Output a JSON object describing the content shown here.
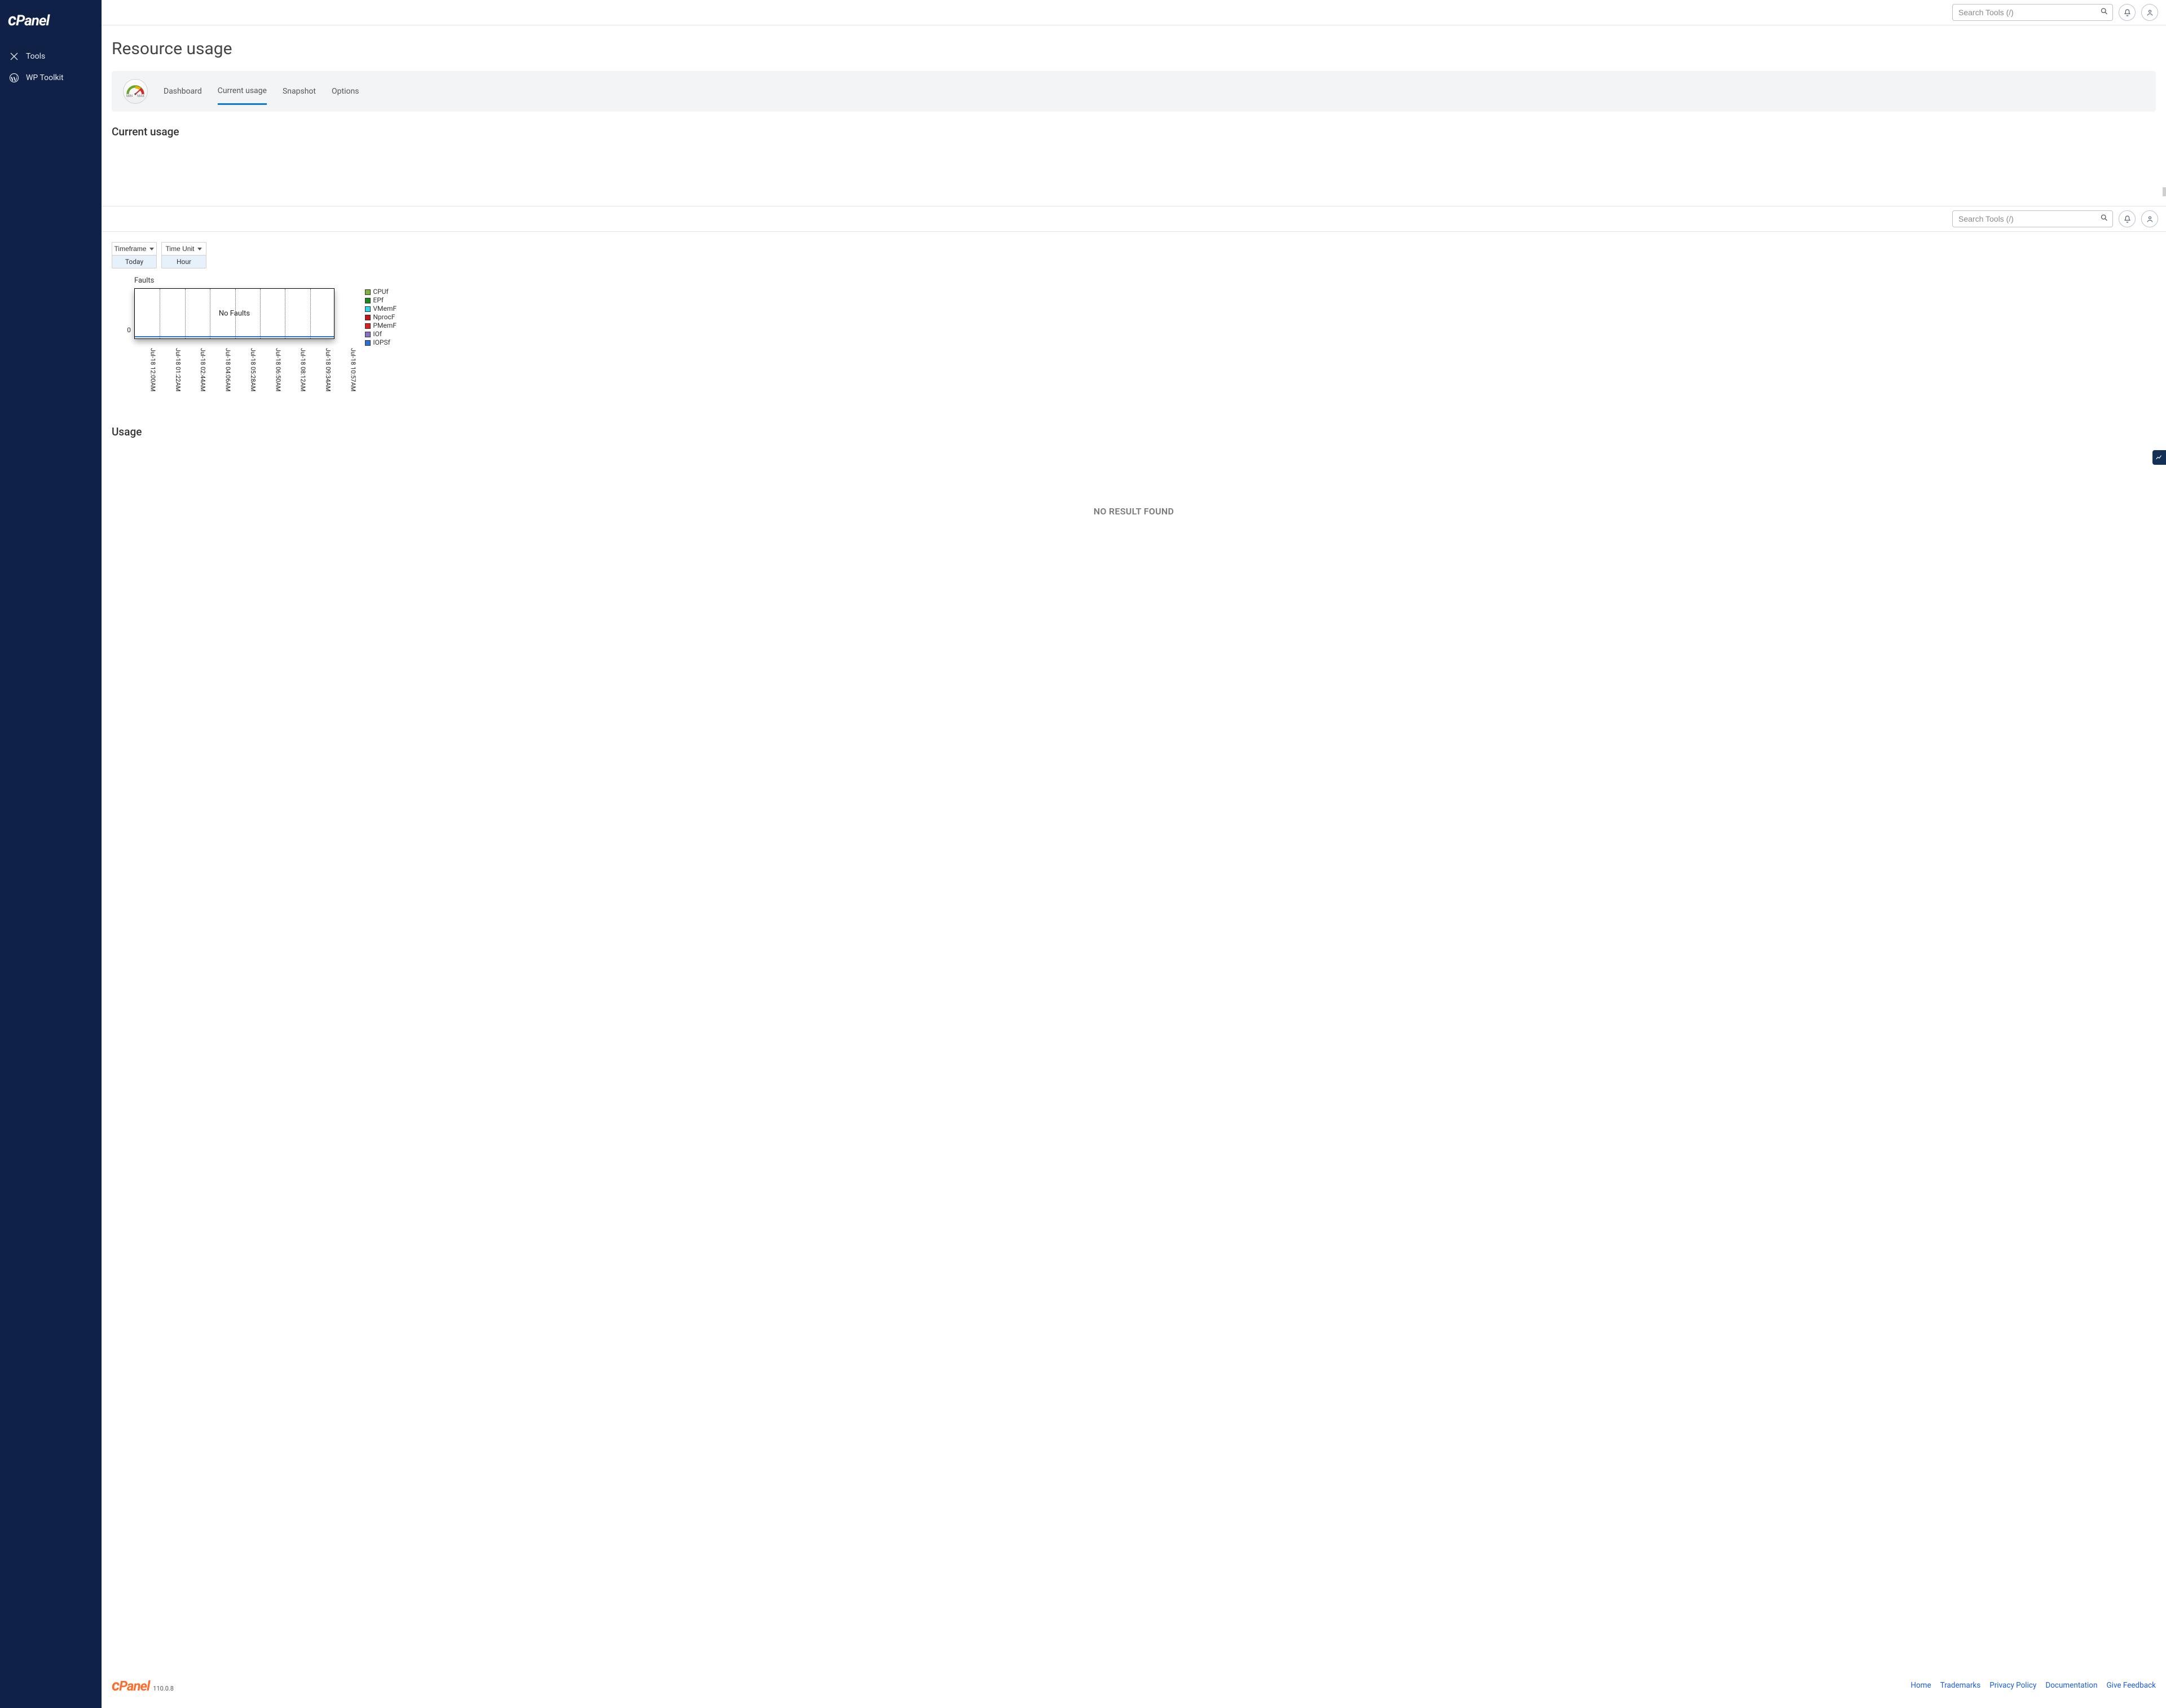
{
  "sidebar": {
    "items": [
      {
        "label": "Tools"
      },
      {
        "label": "WP Toolkit"
      }
    ]
  },
  "header": {
    "search_placeholder": "Search Tools (/)"
  },
  "page": {
    "title": "Resource usage",
    "usage_title": "Usage",
    "no_result": "NO RESULT FOUND"
  },
  "tabs": {
    "gauge_min": "MIN",
    "gauge_max": "MAX",
    "items": [
      {
        "label": "Dashboard"
      },
      {
        "label": "Current usage"
      },
      {
        "label": "Snapshot"
      },
      {
        "label": "Options"
      }
    ],
    "active": 1,
    "section_title": "Current usage"
  },
  "controls": {
    "timeframe_label": "Timeframe",
    "timeframe_value": "Today",
    "timeunit_label": "Time Unit",
    "timeunit_value": "Hour"
  },
  "chart_data": {
    "type": "line",
    "title": "Faults",
    "message": "No Faults",
    "ylabel": "",
    "y_ticks": [
      "0"
    ],
    "categories": [
      "Jul-18 12:00AM",
      "Jul-18 01:22AM",
      "Jul-18 02:44AM",
      "Jul-18 04:06AM",
      "Jul-18 05:28AM",
      "Jul-18 06:50AM",
      "Jul-18 08:12AM",
      "Jul-18 09:34AM",
      "Jul-18 10:57AM"
    ],
    "series": [
      {
        "name": "CPUf",
        "color": "#7db33a",
        "values": [
          0,
          0,
          0,
          0,
          0,
          0,
          0,
          0,
          0
        ]
      },
      {
        "name": "EPf",
        "color": "#1a8a1a",
        "values": [
          0,
          0,
          0,
          0,
          0,
          0,
          0,
          0,
          0
        ]
      },
      {
        "name": "VMemF",
        "color": "#35d4e6",
        "values": [
          0,
          0,
          0,
          0,
          0,
          0,
          0,
          0,
          0
        ]
      },
      {
        "name": "NprocF",
        "color": "#c41616",
        "values": [
          0,
          0,
          0,
          0,
          0,
          0,
          0,
          0,
          0
        ]
      },
      {
        "name": "PMemF",
        "color": "#d81f1f",
        "values": [
          0,
          0,
          0,
          0,
          0,
          0,
          0,
          0,
          0
        ]
      },
      {
        "name": "IOf",
        "color": "#8a6fc7",
        "values": [
          0,
          0,
          0,
          0,
          0,
          0,
          0,
          0,
          0
        ]
      },
      {
        "name": "IOPSf",
        "color": "#2a6fd6",
        "values": [
          0,
          0,
          0,
          0,
          0,
          0,
          0,
          0,
          0
        ]
      }
    ]
  },
  "footer": {
    "version": "110.0.8",
    "links": [
      {
        "label": "Home"
      },
      {
        "label": "Trademarks"
      },
      {
        "label": "Privacy Policy"
      },
      {
        "label": "Documentation"
      },
      {
        "label": "Give Feedback"
      }
    ]
  }
}
